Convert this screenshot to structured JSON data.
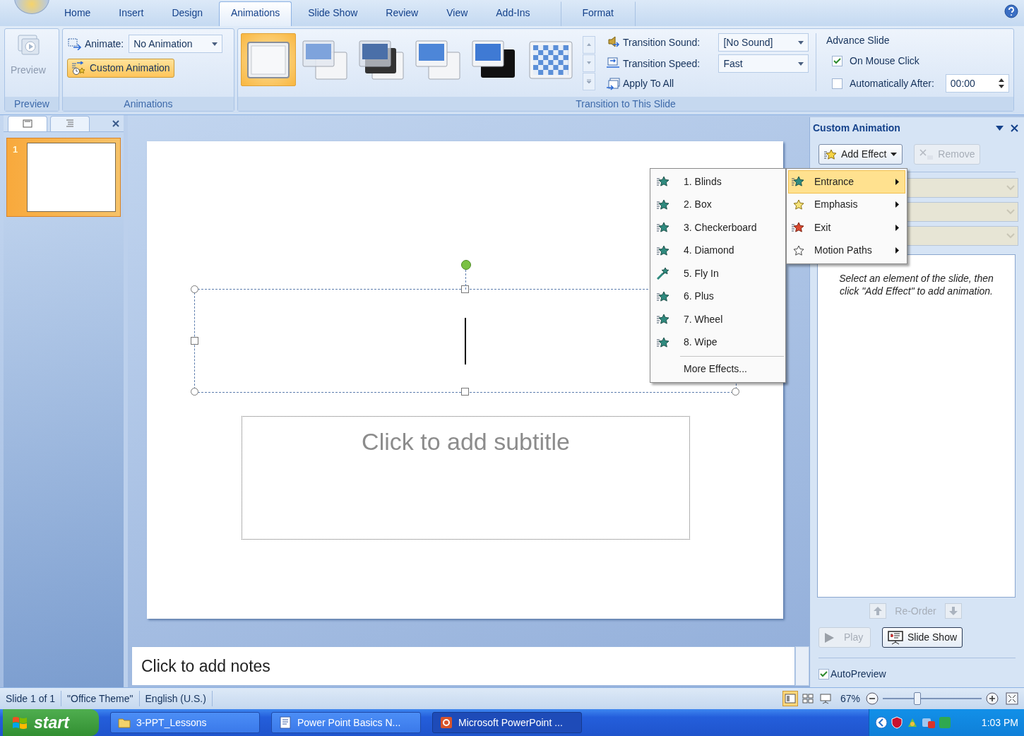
{
  "ribbon_tabs": [
    {
      "label": "Home",
      "selected": false
    },
    {
      "label": "Insert",
      "selected": false
    },
    {
      "label": "Design",
      "selected": false
    },
    {
      "label": "Animations",
      "selected": true
    },
    {
      "label": "Slide Show",
      "selected": false
    },
    {
      "label": "Review",
      "selected": false
    },
    {
      "label": "View",
      "selected": false
    },
    {
      "label": "Add-Ins",
      "selected": false
    },
    {
      "label": "Format",
      "selected": false
    }
  ],
  "preview_group": {
    "button": {
      "label": "Preview",
      "disabled": true
    },
    "caption": "Preview"
  },
  "animations_group": {
    "animate_label": "Animate:",
    "animate_value": "No Animation",
    "custom_animation": {
      "label": "Custom Animation",
      "active": true
    },
    "caption": "Animations"
  },
  "transition_group": {
    "gallery": [
      {
        "kind": "none",
        "selected": true
      },
      {
        "kind": "fade",
        "selected": false
      },
      {
        "kind": "dark",
        "selected": false
      },
      {
        "kind": "light",
        "selected": false
      },
      {
        "kind": "black",
        "selected": false
      },
      {
        "kind": "checker",
        "selected": false
      }
    ],
    "sound_label": "Transition Sound:",
    "sound_value": "[No Sound]",
    "speed_label": "Transition Speed:",
    "speed_value": "Fast",
    "apply_all": "Apply To All",
    "advance_title": "Advance Slide",
    "options": [
      {
        "label": "On Mouse Click",
        "checked": true
      },
      {
        "label": "Automatically After:",
        "checked": false
      }
    ],
    "time_value": "00:00",
    "caption": "Transition to This Slide"
  },
  "slides_pane": {
    "slides": [
      {
        "number": "1",
        "selected": true
      }
    ]
  },
  "slide": {
    "subtitle_placeholder": "Click to add subtitle"
  },
  "notes": {
    "placeholder": "Click to add notes"
  },
  "task_pane": {
    "title": "Custom Animation",
    "add_effect": "Add Effect",
    "remove": {
      "label": "Remove",
      "disabled": true
    },
    "hint": "Select an element of the slide, then click \"Add Effect\" to add animation.",
    "reorder": "Re-Order",
    "play": {
      "label": "Play",
      "disabled": true
    },
    "slide_show": "Slide Show",
    "autopreview": {
      "label": "AutoPreview",
      "checked": true
    }
  },
  "effect_menu": [
    {
      "label": "Entrance",
      "kind": "entrance",
      "selected": true
    },
    {
      "label": "Emphasis",
      "kind": "emphasis",
      "selected": false
    },
    {
      "label": "Exit",
      "kind": "exit",
      "selected": false
    },
    {
      "label": "Motion Paths",
      "kind": "motion",
      "selected": false
    }
  ],
  "entrance_submenu": {
    "items": [
      {
        "label": "1. Blinds",
        "kind": "star"
      },
      {
        "label": "2. Box",
        "kind": "star"
      },
      {
        "label": "3. Checkerboard",
        "kind": "star"
      },
      {
        "label": "4. Diamond",
        "kind": "star"
      },
      {
        "label": "5. Fly In",
        "kind": "fly"
      },
      {
        "label": "6. Plus",
        "kind": "star"
      },
      {
        "label": "7. Wheel",
        "kind": "star"
      },
      {
        "label": "8. Wipe",
        "kind": "star"
      }
    ],
    "more": "More Effects..."
  },
  "status_bar": {
    "slide": "Slide 1 of 1",
    "theme": "\"Office Theme\"",
    "language": "English (U.S.)",
    "views": [
      {
        "kind": "normal",
        "selected": true
      },
      {
        "kind": "sorter",
        "selected": false
      },
      {
        "kind": "show",
        "selected": false
      }
    ],
    "zoom": "67%",
    "zoom_slider": {
      "level": 0.35
    }
  },
  "taskbar": {
    "start": "start",
    "tasks": [
      {
        "label": "3-PPT_Lessons",
        "kind": "folder",
        "selected": false
      },
      {
        "label": "Power Point Basics N...",
        "kind": "doc",
        "selected": false
      },
      {
        "label": "Microsoft PowerPoint ...",
        "kind": "ppt",
        "selected": true
      }
    ],
    "clock": "1:03 PM"
  }
}
